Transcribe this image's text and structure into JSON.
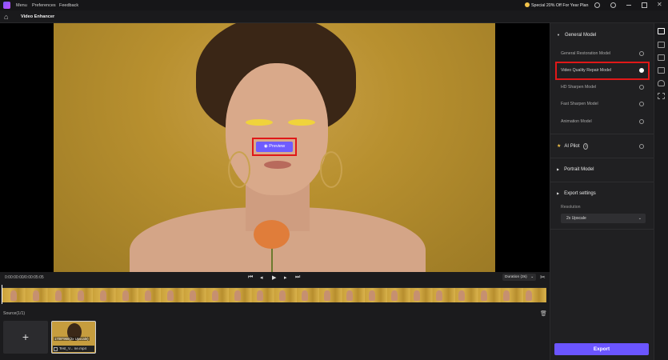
{
  "menu": {
    "items": [
      "Menu",
      "Preferences",
      "Feedback"
    ]
  },
  "promo": "Special 20% Off For Year Plan",
  "nav": {
    "title": "Video Enhancer"
  },
  "viewer": {
    "preview_label": "Preview"
  },
  "player": {
    "timecode": "0:00:00:00/0:00:05:05",
    "duration_label": "Duration (3s)"
  },
  "source": {
    "label": "Source(1/1)",
    "add_symbol": "+"
  },
  "thumb": {
    "caption": "1708*960(2x Upscale)",
    "filename": "Test_V... ne.mp4"
  },
  "panel": {
    "general_title": "General Model",
    "models": [
      {
        "label": "General Restoration Model",
        "selected": false
      },
      {
        "label": "Video Quality Repair Model",
        "selected": true
      },
      {
        "label": "HD Sharpen Model",
        "selected": false
      },
      {
        "label": "Fast Sharpen Model",
        "selected": false
      },
      {
        "label": "Animation Model",
        "selected": false
      }
    ],
    "ai_pilot": "AI Pilot",
    "portrait": "Portrait Model",
    "export_settings": "Export settings",
    "resolution_label": "Resolution",
    "resolution_value": "2x Upscale"
  },
  "export_label": "Export",
  "colors": {
    "accent": "#6b55ff",
    "highlight": "#e01818",
    "star": "#f2c34a"
  }
}
